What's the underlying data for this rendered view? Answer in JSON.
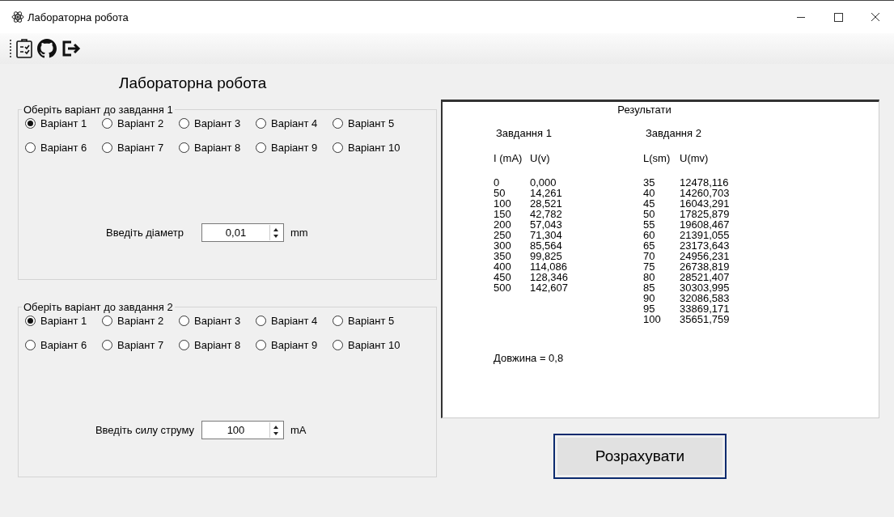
{
  "window": {
    "title": "Лабораторна робота"
  },
  "heading": "Лабораторна робота",
  "groups": [
    {
      "title": "Оберіть варіант до завдання 1",
      "options": [
        {
          "label": "Варіант 1",
          "selected": true
        },
        {
          "label": "Варіант 2",
          "selected": false
        },
        {
          "label": "Варіант 3",
          "selected": false
        },
        {
          "label": "Варіант 4",
          "selected": false
        },
        {
          "label": "Варіант 5",
          "selected": false
        },
        {
          "label": "Варіант 6",
          "selected": false
        },
        {
          "label": "Варіант 7",
          "selected": false
        },
        {
          "label": "Варіант 8",
          "selected": false
        },
        {
          "label": "Варіант 9",
          "selected": false
        },
        {
          "label": "Варіант 10",
          "selected": false
        }
      ],
      "input": {
        "label": "Введіть діаметр",
        "value": "0,01",
        "unit": "mm"
      }
    },
    {
      "title": "Оберіть варіант до завдання 2",
      "options": [
        {
          "label": "Варіант 1",
          "selected": true
        },
        {
          "label": "Варіант 2",
          "selected": false
        },
        {
          "label": "Варіант 3",
          "selected": false
        },
        {
          "label": "Варіант 4",
          "selected": false
        },
        {
          "label": "Варіант 5",
          "selected": false
        },
        {
          "label": "Варіант 6",
          "selected": false
        },
        {
          "label": "Варіант 7",
          "selected": false
        },
        {
          "label": "Варіант 8",
          "selected": false
        },
        {
          "label": "Варіант 9",
          "selected": false
        },
        {
          "label": "Варіант 10",
          "selected": false
        }
      ],
      "input": {
        "label": "Введіть силу струму",
        "value": "100",
        "unit": "mA"
      }
    }
  ],
  "results": {
    "title": "Результати",
    "tasks": [
      {
        "heading": "Завдання 1",
        "columns": [
          "I (mA)",
          "U(v)"
        ],
        "rows": [
          [
            "0",
            "0,000"
          ],
          [
            "50",
            "14,261"
          ],
          [
            "100",
            "28,521"
          ],
          [
            "150",
            "42,782"
          ],
          [
            "200",
            "57,043"
          ],
          [
            "250",
            "71,304"
          ],
          [
            "300",
            "85,564"
          ],
          [
            "350",
            "99,825"
          ],
          [
            "400",
            "114,086"
          ],
          [
            "450",
            "128,346"
          ],
          [
            "500",
            "142,607"
          ]
        ]
      },
      {
        "heading": "Завдання 2",
        "columns": [
          "L(sm)",
          "U(mv)"
        ],
        "rows": [
          [
            "35",
            "12478,116"
          ],
          [
            "40",
            "14260,703"
          ],
          [
            "45",
            "16043,291"
          ],
          [
            "50",
            "17825,879"
          ],
          [
            "55",
            "19608,467"
          ],
          [
            "60",
            "21391,055"
          ],
          [
            "65",
            "23173,643"
          ],
          [
            "70",
            "24956,231"
          ],
          [
            "75",
            "26738,819"
          ],
          [
            "80",
            "28521,407"
          ],
          [
            "85",
            "30303,995"
          ],
          [
            "90",
            "32086,583"
          ],
          [
            "95",
            "33869,171"
          ],
          [
            "100",
            "35651,759"
          ]
        ]
      }
    ],
    "footer": "Довжина = 0,8"
  },
  "button": "Розрахувати"
}
